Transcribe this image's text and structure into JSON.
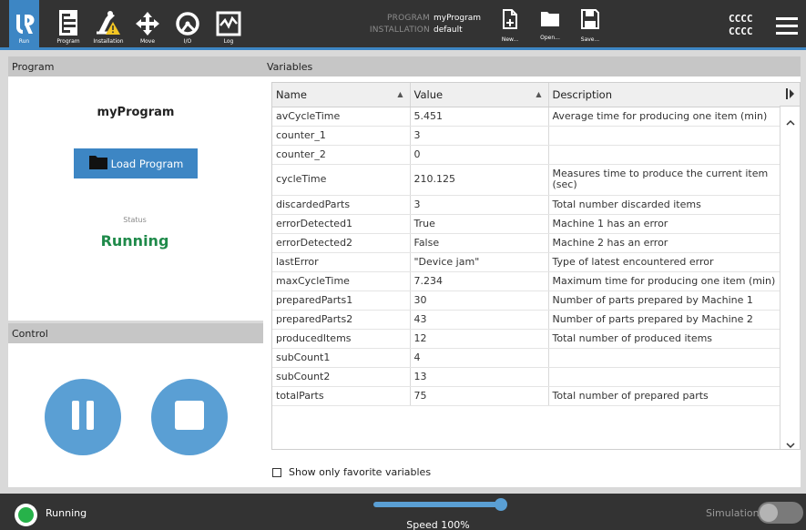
{
  "nav": {
    "items": [
      {
        "label": "Run",
        "icon": "ur-logo-icon",
        "active": true
      },
      {
        "label": "Program",
        "icon": "program-icon"
      },
      {
        "label": "Installation",
        "icon": "installation-warning-icon"
      },
      {
        "label": "Move",
        "icon": "move-arrows-icon"
      },
      {
        "label": "I/O",
        "icon": "io-gauge-icon"
      },
      {
        "label": "Log",
        "icon": "log-chart-icon"
      }
    ]
  },
  "header": {
    "program_label": "PROGRAM",
    "program_value": "myProgram",
    "installation_label": "INSTALLATION",
    "installation_value": "default",
    "file_buttons": [
      {
        "label": "New...",
        "icon": "new-file-icon"
      },
      {
        "label": "Open...",
        "icon": "open-folder-icon"
      },
      {
        "label": "Save...",
        "icon": "save-disk-icon"
      }
    ],
    "user_line1": "CCCC",
    "user_line2": "CCCC"
  },
  "program_panel": {
    "title": "Program",
    "program_name": "myProgram",
    "load_button": "Load Program",
    "status_label": "Status",
    "status_value": "Running"
  },
  "control_panel": {
    "title": "Control",
    "pause_icon": "pause-icon",
    "stop_icon": "stop-icon"
  },
  "variables_panel": {
    "title": "Variables",
    "columns": [
      "Name",
      "Value",
      "Description"
    ],
    "rows": [
      {
        "name": "avCycleTime",
        "value": "5.451",
        "description": "Average time for producing one item (min)"
      },
      {
        "name": "counter_1",
        "value": "3",
        "description": ""
      },
      {
        "name": "counter_2",
        "value": "0",
        "description": ""
      },
      {
        "name": "cycleTime",
        "value": "210.125",
        "description": "Measures time to produce the current item (sec)"
      },
      {
        "name": "discardedParts",
        "value": "3",
        "description": "Total number discarded items"
      },
      {
        "name": "errorDetected1",
        "value": "True",
        "description": "Machine 1 has an error"
      },
      {
        "name": "errorDetected2",
        "value": "False",
        "description": "Machine 2 has an error"
      },
      {
        "name": "lastError",
        "value": "\"Device jam\"",
        "description": "Type of latest encountered error"
      },
      {
        "name": "maxCycleTime",
        "value": "7.234",
        "description": "Maximum time for producing one item (min)"
      },
      {
        "name": "preparedParts1",
        "value": "30",
        "description": "Number of parts prepared by Machine 1"
      },
      {
        "name": "preparedParts2",
        "value": "43",
        "description": "Number of parts prepared by Machine 2"
      },
      {
        "name": "producedItems",
        "value": "12",
        "description": "Total number of produced items"
      },
      {
        "name": "subCount1",
        "value": "4",
        "description": ""
      },
      {
        "name": "subCount2",
        "value": "13",
        "description": ""
      },
      {
        "name": "totalParts",
        "value": "75",
        "description": "Total number of prepared parts"
      }
    ],
    "favorites_checkbox_label": "Show only favorite variables",
    "favorites_checked": false
  },
  "footer": {
    "robot_state": "Running",
    "speed_label": "Speed 100%",
    "speed_value": 100,
    "simulation_label": "Simulation",
    "simulation_on": false
  },
  "colors": {
    "topbar": "#333333",
    "accent": "#3d86c4",
    "running_green": "#1f8a4a",
    "control_button": "#5a9fd4"
  }
}
